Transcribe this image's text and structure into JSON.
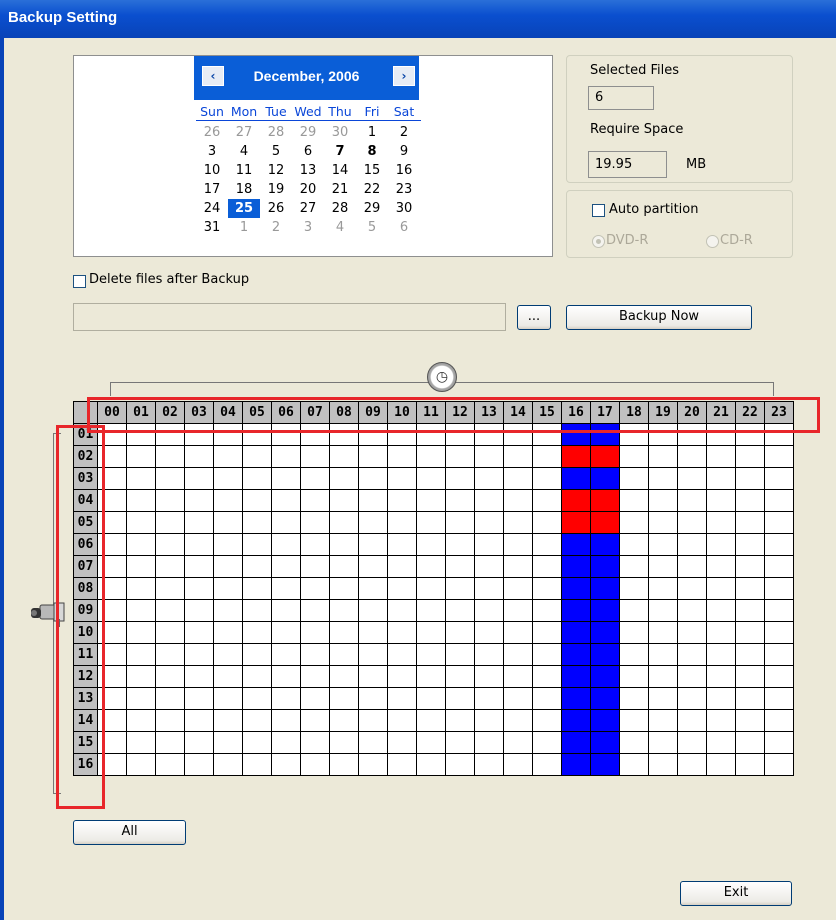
{
  "window": {
    "title": "Backup Setting"
  },
  "calendar": {
    "month_label": "December, 2006",
    "prev_icon": "‹",
    "next_icon": "›",
    "weekdays": [
      "Sun",
      "Mon",
      "Tue",
      "Wed",
      "Thu",
      "Fri",
      "Sat"
    ],
    "weeks": [
      [
        {
          "t": "26",
          "s": "dim"
        },
        {
          "t": "27",
          "s": "dim"
        },
        {
          "t": "28",
          "s": "dim"
        },
        {
          "t": "29",
          "s": "dim"
        },
        {
          "t": "30",
          "s": "dim"
        },
        {
          "t": "1",
          "s": ""
        },
        {
          "t": "2",
          "s": ""
        }
      ],
      [
        {
          "t": "3",
          "s": ""
        },
        {
          "t": "4",
          "s": ""
        },
        {
          "t": "5",
          "s": ""
        },
        {
          "t": "6",
          "s": ""
        },
        {
          "t": "7",
          "s": "bold"
        },
        {
          "t": "8",
          "s": "bold"
        },
        {
          "t": "9",
          "s": ""
        }
      ],
      [
        {
          "t": "10",
          "s": ""
        },
        {
          "t": "11",
          "s": ""
        },
        {
          "t": "12",
          "s": ""
        },
        {
          "t": "13",
          "s": ""
        },
        {
          "t": "14",
          "s": ""
        },
        {
          "t": "15",
          "s": ""
        },
        {
          "t": "16",
          "s": ""
        }
      ],
      [
        {
          "t": "17",
          "s": ""
        },
        {
          "t": "18",
          "s": ""
        },
        {
          "t": "19",
          "s": ""
        },
        {
          "t": "20",
          "s": ""
        },
        {
          "t": "21",
          "s": ""
        },
        {
          "t": "22",
          "s": ""
        },
        {
          "t": "23",
          "s": ""
        }
      ],
      [
        {
          "t": "24",
          "s": ""
        },
        {
          "t": "25",
          "s": "sel"
        },
        {
          "t": "26",
          "s": ""
        },
        {
          "t": "27",
          "s": ""
        },
        {
          "t": "28",
          "s": ""
        },
        {
          "t": "29",
          "s": ""
        },
        {
          "t": "30",
          "s": ""
        }
      ],
      [
        {
          "t": "31",
          "s": ""
        },
        {
          "t": "1",
          "s": "dim"
        },
        {
          "t": "2",
          "s": "dim"
        },
        {
          "t": "3",
          "s": "dim"
        },
        {
          "t": "4",
          "s": "dim"
        },
        {
          "t": "5",
          "s": "dim"
        },
        {
          "t": "6",
          "s": "dim"
        }
      ]
    ]
  },
  "info": {
    "selected_files_label": "Selected Files",
    "selected_files_value": "6",
    "require_space_label": "Require Space",
    "require_space_value": "19.95",
    "unit": "MB"
  },
  "partition": {
    "auto_label": "Auto partition",
    "dvd_label": "DVD-R",
    "cd_label": "CD-R"
  },
  "options": {
    "delete_after_label": "Delete files after Backup"
  },
  "buttons": {
    "browse": "...",
    "backup_now": "Backup Now",
    "all": "All",
    "exit": "Exit"
  },
  "grid": {
    "hours": [
      "00",
      "01",
      "02",
      "03",
      "04",
      "05",
      "06",
      "07",
      "08",
      "09",
      "10",
      "11",
      "12",
      "13",
      "14",
      "15",
      "16",
      "17",
      "18",
      "19",
      "20",
      "21",
      "22",
      "23"
    ],
    "channels": [
      "01",
      "02",
      "03",
      "04",
      "05",
      "06",
      "07",
      "08",
      "09",
      "10",
      "11",
      "12",
      "13",
      "14",
      "15",
      "16"
    ],
    "recorded_hours": [
      16,
      17
    ],
    "selected": [
      {
        "ch": "02",
        "hours": [
          16,
          17
        ]
      },
      {
        "ch": "04",
        "hours": [
          16,
          17
        ]
      },
      {
        "ch": "05",
        "hours": [
          16,
          17
        ]
      }
    ],
    "colors": {
      "recorded": "#0000ff",
      "selected": "#ff0000"
    }
  },
  "icons": {
    "clock": "clock-icon",
    "camera": "camera-icon"
  }
}
